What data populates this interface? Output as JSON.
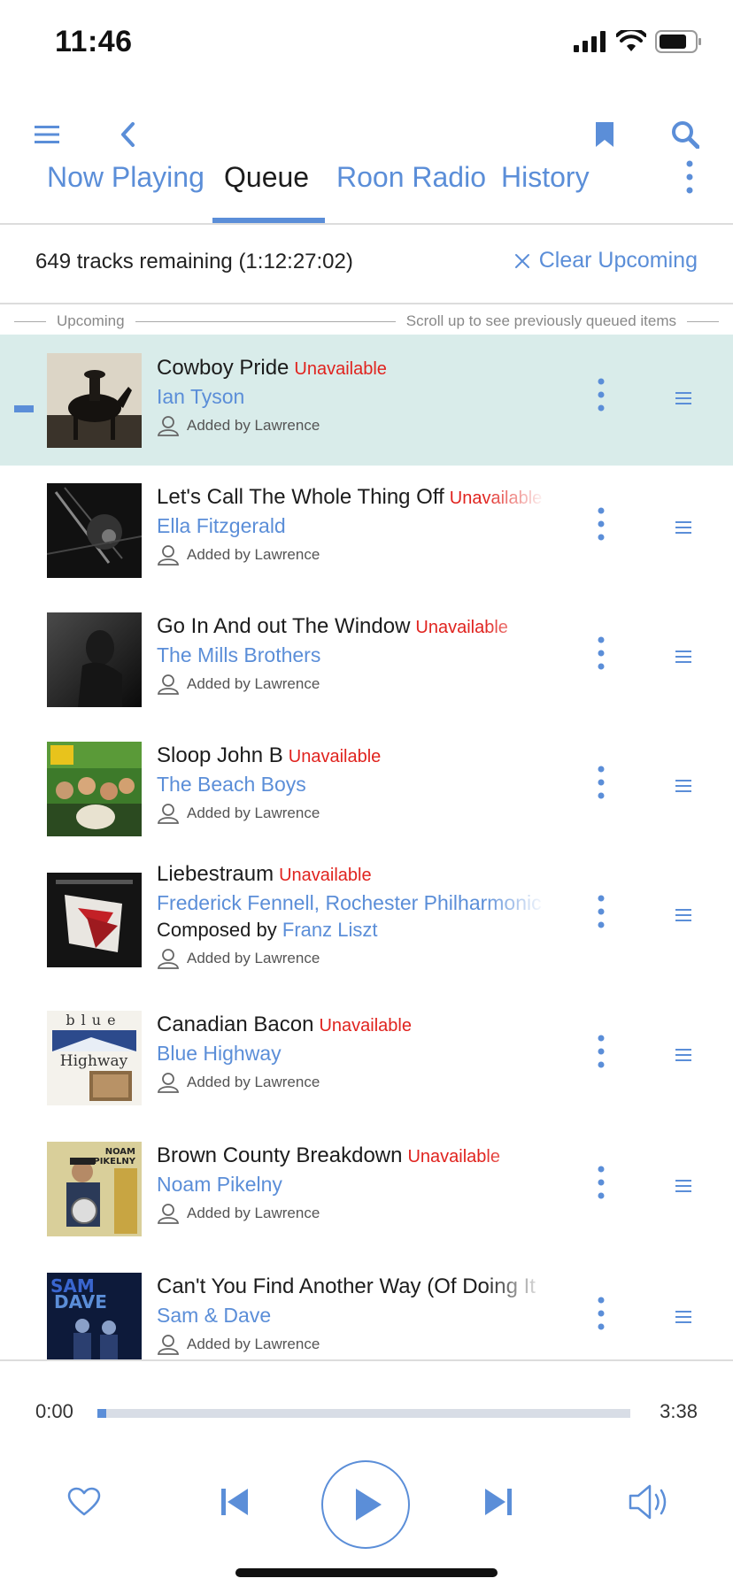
{
  "status": {
    "time": "11:46"
  },
  "toolbar": {
    "menu": "menu-icon",
    "back": "chevron-left-icon",
    "bookmark": "bookmark-icon",
    "search": "search-icon"
  },
  "tabs": [
    {
      "label": "Now Playing"
    },
    {
      "label": "Queue",
      "active": true
    },
    {
      "label": "Roon Radio"
    },
    {
      "label": "History"
    }
  ],
  "summary": {
    "text": "649 tracks remaining (1:12:27:02)",
    "clear_label": "Clear Upcoming"
  },
  "divider": {
    "left": "Upcoming",
    "right": "Scroll up to see previously queued items"
  },
  "queue": [
    {
      "title": "Cowboy Pride",
      "status": "Unavailable",
      "artist": "Ian Tyson",
      "added": "Added by Lawrence",
      "current": true
    },
    {
      "title": "Let's Call The Whole Thing Off",
      "status": "Unavailable",
      "artist": "Ella Fitzgerald",
      "added": "Added by Lawrence"
    },
    {
      "title": "Go In And out The Window",
      "status": "Unavailable",
      "artist": "The Mills Brothers",
      "added": "Added by Lawrence"
    },
    {
      "title": "Sloop John B",
      "status": "Unavailable",
      "artist": "The Beach Boys",
      "added": "Added by Lawrence"
    },
    {
      "title": "Liebestraum",
      "status": "Unavailable",
      "artist": "Frederick Fennell, Rochester Philharmonic",
      "composer_prefix": "Composed by",
      "composer": "Franz Liszt",
      "added": "Added by Lawrence"
    },
    {
      "title": "Canadian Bacon",
      "status": "Unavailable",
      "artist": "Blue Highway",
      "added": "Added by Lawrence"
    },
    {
      "title": "Brown County Breakdown",
      "status": "Unavailable",
      "artist": "Noam Pikelny",
      "added": "Added by Lawrence"
    },
    {
      "title": "Can't You Find Another Way (Of Doing It",
      "status": "",
      "artist": "Sam & Dave",
      "added": "Added by Lawrence"
    }
  ],
  "player": {
    "elapsed": "0:00",
    "total": "3:38",
    "progress_fraction": 0.0
  },
  "colors": {
    "accent": "#5b8ed8",
    "unavailable": "#e0231e",
    "current_row": "#d9ecea"
  }
}
